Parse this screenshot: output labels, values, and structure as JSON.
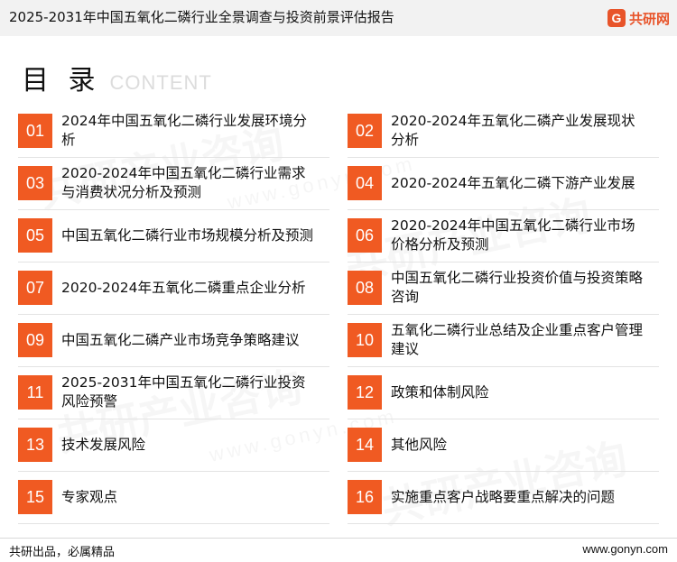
{
  "header": {
    "report_title": "2025-2031年中国五氧化二磷行业全景调查与投资前景评估报告",
    "logo_mark": "G",
    "logo_text": "共研网"
  },
  "toc": {
    "title": "目 录",
    "subtitle": "CONTENT",
    "items": [
      {
        "num": "01",
        "text": "2024年中国五氧化二磷行业发展环境分析"
      },
      {
        "num": "02",
        "text": "2020-2024年五氧化二磷产业发展现状分析"
      },
      {
        "num": "03",
        "text": "2020-2024年中国五氧化二磷行业需求与消费状况分析及预测"
      },
      {
        "num": "04",
        "text": "2020-2024年五氧化二磷下游产业发展"
      },
      {
        "num": "05",
        "text": "中国五氧化二磷行业市场规模分析及预测"
      },
      {
        "num": "06",
        "text": "2020-2024年中国五氧化二磷行业市场价格分析及预测"
      },
      {
        "num": "07",
        "text": "2020-2024年五氧化二磷重点企业分析"
      },
      {
        "num": "08",
        "text": "中国五氧化二磷行业投资价值与投资策略咨询"
      },
      {
        "num": "09",
        "text": "中国五氧化二磷产业市场竞争策略建议"
      },
      {
        "num": "10",
        "text": "五氧化二磷行业总结及企业重点客户管理建议"
      },
      {
        "num": "11",
        "text": "2025-2031年中国五氧化二磷行业投资风险预警"
      },
      {
        "num": "12",
        "text": "政策和体制风险"
      },
      {
        "num": "13",
        "text": "技术发展风险"
      },
      {
        "num": "14",
        "text": "其他风险"
      },
      {
        "num": "15",
        "text": "专家观点"
      },
      {
        "num": "16",
        "text": "实施重点客户战略要重点解决的问题"
      }
    ]
  },
  "footer": {
    "slogan": "共研出品，必属精品",
    "website": "www.gonyn.com"
  },
  "colors": {
    "accent": "#f05a22",
    "topbar_bg": "#f2f2f2"
  }
}
